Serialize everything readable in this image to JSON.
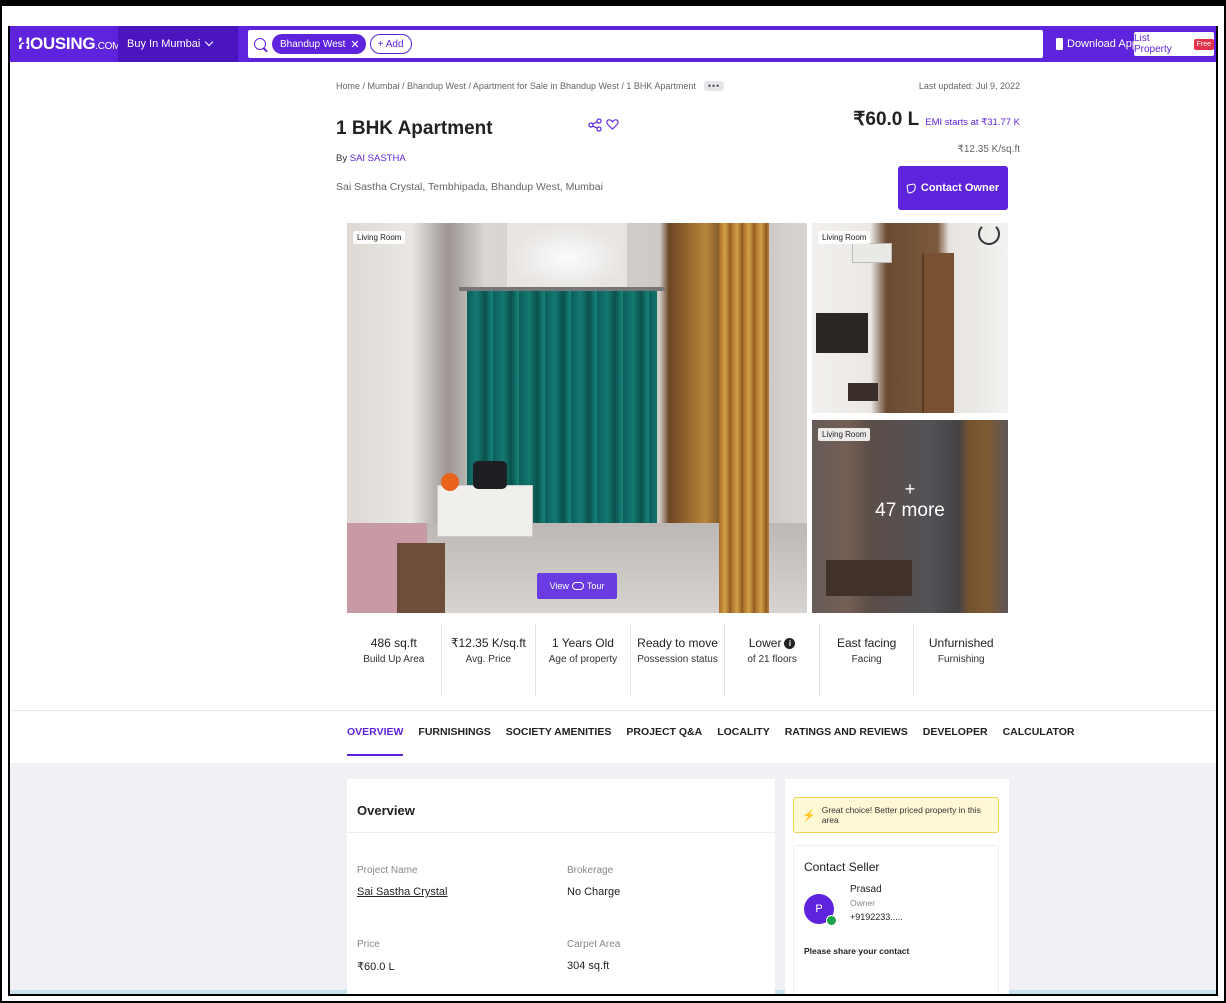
{
  "header": {
    "logo_text": "HOUSING",
    "logo_suffix": ".COM",
    "city_label": "Buy In Mumbai",
    "search_chip": "Bhandup West",
    "add_label": "+ Add",
    "download_app": "Download App",
    "list_property": "List Property",
    "free_badge": "Free",
    "brand_color": "#5e23dc"
  },
  "breadcrumb": {
    "text": "Home / Mumbai / Bhandup West / Apartment for Sale in Bhandup West / 1 BHK Apartment",
    "more": "•••",
    "updated": "Last updated: Jul 9, 2022"
  },
  "listing": {
    "title": "1 BHK Apartment",
    "by_prefix": "By",
    "developer": "SAI SASTHA",
    "address": "Sai Sastha Crystal, Tembhipada, Bhandup West, Mumbai",
    "price": "₹60.0 L",
    "emi": "EMI starts at ₹31.77 K",
    "per_sqft": "₹12.35 K/sq.ft",
    "contact_button": "Contact Owner"
  },
  "gallery": {
    "main_tag": "Living Room",
    "tour_prefix": "View",
    "tour_suffix": "Tour",
    "side_top_tag": "Living Room",
    "side_bottom_tag": "Living Room",
    "more_plus": "+",
    "more_count": "47 more"
  },
  "stats": [
    {
      "value": "486 sq.ft",
      "label": "Build Up Area"
    },
    {
      "value": "₹12.35 K/sq.ft",
      "label": "Avg. Price"
    },
    {
      "value": "1 Years Old",
      "label": "Age of property"
    },
    {
      "value": "Ready to move",
      "label": "Possession status"
    },
    {
      "value": "Lower",
      "label": "of 21 floors",
      "info": "i"
    },
    {
      "value": "East facing",
      "label": "Facing"
    },
    {
      "value": "Unfurnished",
      "label": "Furnishing"
    }
  ],
  "tabs": [
    "OVERVIEW",
    "FURNISHINGS",
    "SOCIETY AMENITIES",
    "PROJECT Q&A",
    "LOCALITY",
    "RATINGS AND REVIEWS",
    "DEVELOPER",
    "CALCULATOR"
  ],
  "overview": {
    "title": "Overview",
    "fields": [
      {
        "key": "Project Name",
        "value": "Sai Sastha Crystal"
      },
      {
        "key": "Brokerage",
        "value": "No Charge"
      },
      {
        "key": "Price",
        "value": "₹60.0 L"
      },
      {
        "key": "Carpet Area",
        "value": "304 sq.ft"
      }
    ]
  },
  "side": {
    "promo": "Great choice! Better priced property in this area",
    "contact_title": "Contact Seller",
    "avatar_initial": "P",
    "seller_name": "Prasad",
    "seller_role": "Owner",
    "seller_phone": "+9192233.....",
    "share_prompt": "Please share your contact"
  }
}
